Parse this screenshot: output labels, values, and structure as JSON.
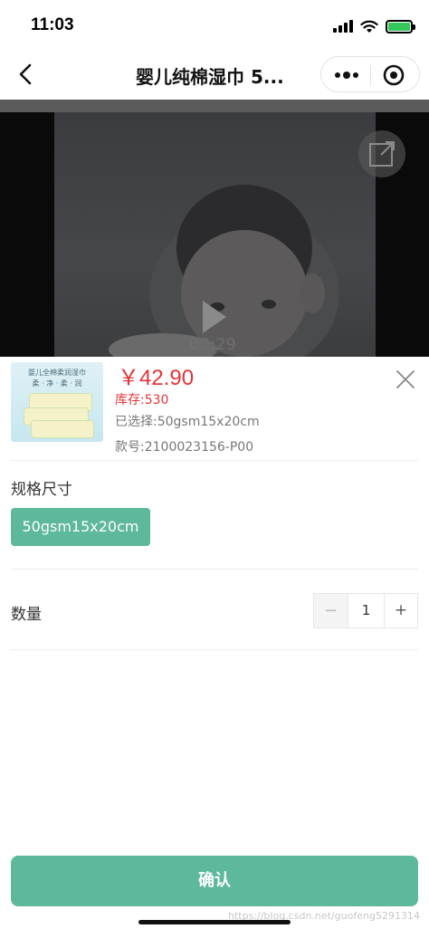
{
  "status_bar": {
    "time": "11:03"
  },
  "nav": {
    "title": "婴儿纯棉湿巾 5..."
  },
  "video": {
    "duration": "00:29"
  },
  "product": {
    "image_text": {
      "line1": "婴儿全棉柔润湿巾",
      "line2": "柔 · 净 · 柔 · 润"
    },
    "price": "￥42.90",
    "stock": "库存:530",
    "selected": "已选择:50gsm15x20cm",
    "sku": "款号:2100023156-P00"
  },
  "spec": {
    "label": "规格尺寸",
    "options": [
      "50gsm15x20cm"
    ],
    "selected": "50gsm15x20cm"
  },
  "quantity": {
    "label": "数量",
    "minus": "−",
    "value": "1",
    "plus": "+"
  },
  "confirm": {
    "label": "确认"
  },
  "watermark": "https://blog.csdn.net/guofeng5291314",
  "colors": {
    "accent": "#5db89c",
    "price": "#e0363a"
  }
}
